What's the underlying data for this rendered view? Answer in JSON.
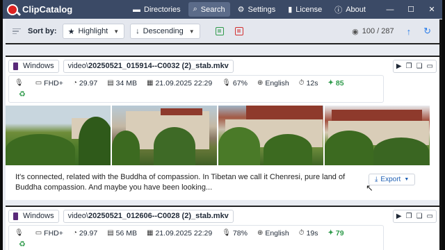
{
  "app": {
    "title": "ClipCatalog"
  },
  "nav": {
    "items": [
      {
        "label": "Directories",
        "icon": "folder-icon"
      },
      {
        "label": "Search",
        "icon": "search-icon",
        "active": true
      },
      {
        "label": "Settings",
        "icon": "gear-icon"
      },
      {
        "label": "License",
        "icon": "license-icon"
      },
      {
        "label": "About",
        "icon": "info-icon"
      }
    ]
  },
  "sortbar": {
    "label": "Sort by:",
    "field": "Highlight",
    "order": "Descending",
    "count": "100 / 287"
  },
  "results": [
    {
      "platform": "Windows",
      "path_prefix": "video\\",
      "filename": "20250521_015914--C0032 (2)_stab.mkv",
      "quality": "FHD+",
      "fps": "29.97",
      "size": "34 MB",
      "date": "21.09.2025 22:29",
      "voice": "67%",
      "language": "English",
      "duration": "12s",
      "score": "85",
      "transcript": "It's connected, related with the Buddha of compassion. In Tibetan we call it Chenresi, pure land of Buddha compassion. And maybe you have been looking...",
      "export_label": "Export"
    },
    {
      "platform": "Windows",
      "path_prefix": "video\\",
      "filename": "20250521_012606--C0028 (2)_stab.mkv",
      "quality": "FHD+",
      "fps": "29.97",
      "size": "56 MB",
      "date": "21.09.2025 22:29",
      "voice": "78%",
      "language": "English",
      "duration": "19s",
      "score": "79"
    }
  ],
  "colors": {
    "nav_bg": "#3b4a66",
    "accent": "#2b7de9",
    "positive": "#2e9a4a",
    "negative": "#d32f2f"
  }
}
